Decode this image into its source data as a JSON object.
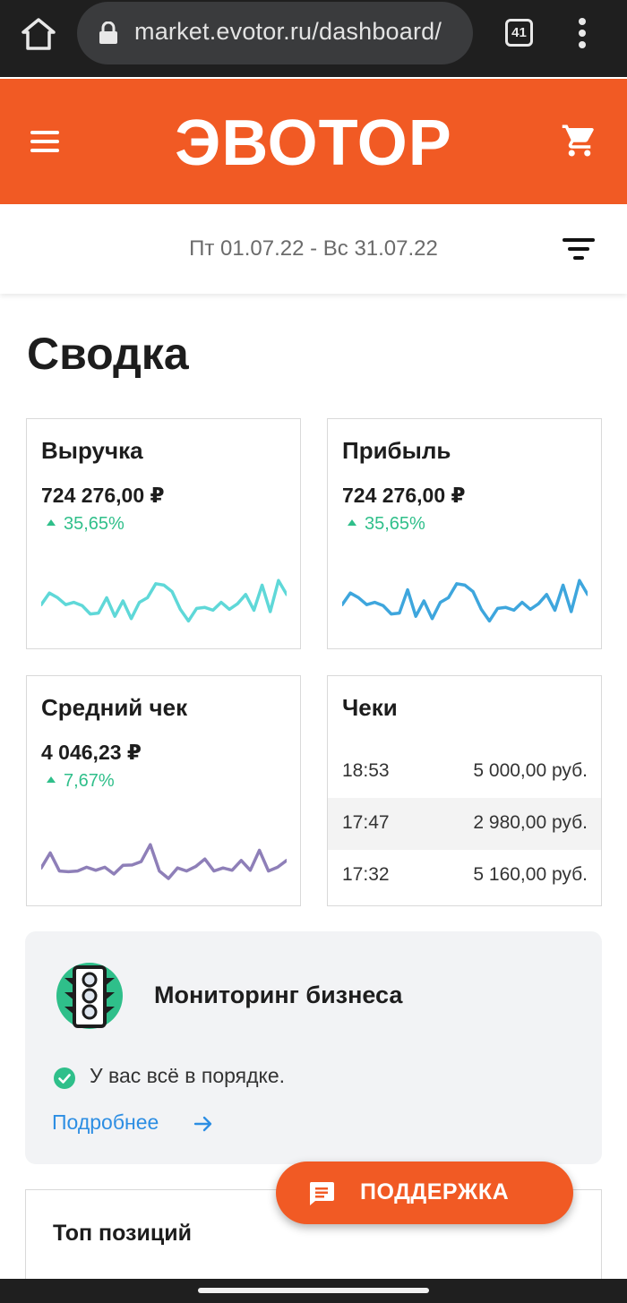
{
  "browser": {
    "url": "market.evotor.ru/dashboard/",
    "tab_count": "41",
    "icons": {
      "home": "home-icon",
      "lock": "lock-icon",
      "menu": "kebab-menu-icon"
    }
  },
  "header": {
    "logo_text": "ЭВОТОР",
    "brand_color": "#f15a24",
    "icons": {
      "menu": "hamburger-icon",
      "cart": "cart-icon"
    }
  },
  "date_range": {
    "label": "Пт 01.07.22 - Вс 31.07.22",
    "filter_icon": "filter-icon"
  },
  "page_title": "Сводка",
  "cards": {
    "revenue": {
      "title": "Выручка",
      "value": "724 276,00 ₽",
      "delta": "35,65%",
      "line_color": "#5fd8d8",
      "trend": [
        0.4,
        0.65,
        0.55,
        0.4,
        0.45,
        0.38,
        0.2,
        0.22,
        0.55,
        0.15,
        0.48,
        0.1,
        0.45,
        0.55,
        0.85,
        0.82,
        0.68,
        0.3,
        0.05,
        0.32,
        0.34,
        0.28,
        0.45,
        0.3,
        0.42,
        0.62,
        0.28,
        0.82,
        0.25,
        0.92,
        0.62
      ]
    },
    "profit": {
      "title": "Прибыль",
      "value": "724 276,00 ₽",
      "delta": "35,65%",
      "line_color": "#3ea6dd",
      "trend": [
        0.4,
        0.65,
        0.55,
        0.4,
        0.45,
        0.38,
        0.2,
        0.22,
        0.72,
        0.15,
        0.48,
        0.1,
        0.45,
        0.55,
        0.85,
        0.82,
        0.68,
        0.3,
        0.05,
        0.32,
        0.34,
        0.28,
        0.45,
        0.3,
        0.42,
        0.62,
        0.28,
        0.82,
        0.25,
        0.92,
        0.62
      ]
    },
    "avg_check": {
      "title": "Средний чек",
      "value": "4 046,23 ₽",
      "delta": "7,67%",
      "line_color": "#8e7fb8",
      "trend": [
        0.28,
        0.68,
        0.2,
        0.18,
        0.2,
        0.3,
        0.22,
        0.3,
        0.12,
        0.35,
        0.36,
        0.45,
        0.9,
        0.2,
        0.0,
        0.28,
        0.2,
        0.32,
        0.52,
        0.2,
        0.28,
        0.22,
        0.48,
        0.22,
        0.75,
        0.2,
        0.3,
        0.48
      ]
    },
    "checks": {
      "title": "Чеки",
      "rows": [
        {
          "time": "18:53",
          "sum": "5 000,00 руб."
        },
        {
          "time": "17:47",
          "sum": "2 980,00 руб."
        },
        {
          "time": "17:32",
          "sum": "5 160,00 руб."
        }
      ]
    },
    "delta_color": "#2fbf8a"
  },
  "monitoring": {
    "title": "Мониторинг бизнеса",
    "status": "У вас всё в порядке.",
    "link": "Подробнее",
    "icons": {
      "main": "traffic-light-icon",
      "status": "check-circle-icon",
      "link": "arrow-right-icon"
    }
  },
  "top_positions": {
    "title": "Топ позиций"
  },
  "support": {
    "label": "ПОДДЕРЖКА",
    "icon": "chat-icon"
  }
}
